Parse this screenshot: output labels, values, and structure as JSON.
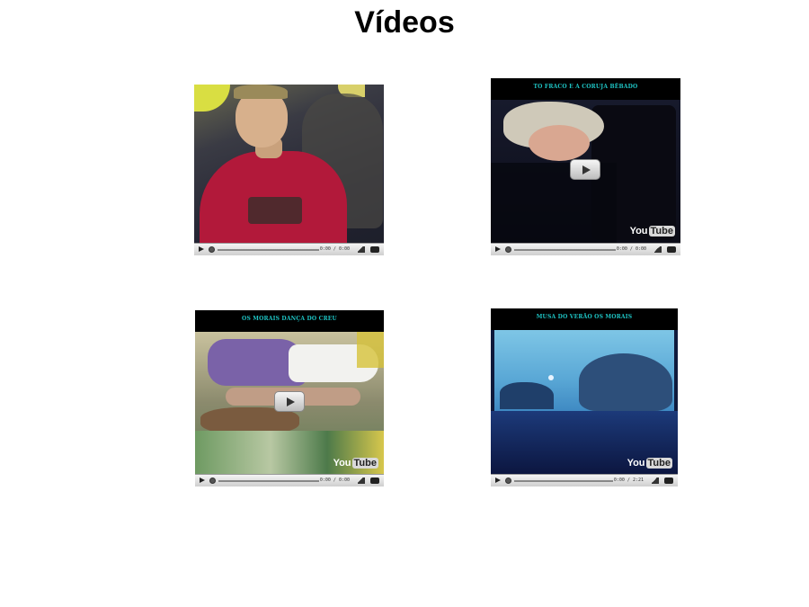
{
  "page": {
    "title": "Vídeos"
  },
  "videos": [
    {
      "header_title": "",
      "has_play_overlay": false,
      "has_youtube_logo": false,
      "time": "0:00 / 0:00"
    },
    {
      "header_title": "TO FRACO E A CORUJA BÊBADO",
      "has_play_overlay": true,
      "has_youtube_logo": true,
      "time": "0:00 / 0:00"
    },
    {
      "header_title": "OS MORAIS DANÇA DO CREU",
      "has_play_overlay": true,
      "has_youtube_logo": true,
      "time": "0:00 / 0:00"
    },
    {
      "header_title": "MUSA DO VERÃO OS MORAIS",
      "has_play_overlay": false,
      "has_youtube_logo": true,
      "time": "0:00 / 2:21"
    }
  ],
  "youtube_logo": {
    "you": "You",
    "tube": "Tube"
  },
  "icons": {
    "play": "play-icon",
    "volume": "volume-icon",
    "fullscreen": "fullscreen-icon"
  },
  "colors": {
    "header_text": "#1ec4c4",
    "player_bg": "#000000",
    "controls_bg": "#d8d8d8"
  }
}
